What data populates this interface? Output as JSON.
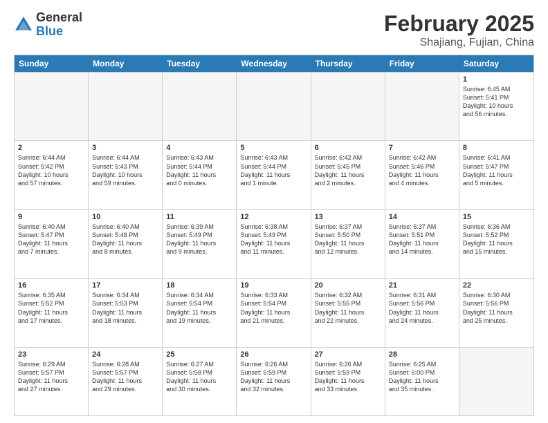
{
  "header": {
    "logo_general": "General",
    "logo_blue": "Blue",
    "month_year": "February 2025",
    "location": "Shajiang, Fujian, China"
  },
  "day_headers": [
    "Sunday",
    "Monday",
    "Tuesday",
    "Wednesday",
    "Thursday",
    "Friday",
    "Saturday"
  ],
  "weeks": [
    [
      {
        "num": "",
        "info": ""
      },
      {
        "num": "",
        "info": ""
      },
      {
        "num": "",
        "info": ""
      },
      {
        "num": "",
        "info": ""
      },
      {
        "num": "",
        "info": ""
      },
      {
        "num": "",
        "info": ""
      },
      {
        "num": "1",
        "info": "Sunrise: 6:45 AM\nSunset: 5:41 PM\nDaylight: 10 hours\nand 56 minutes."
      }
    ],
    [
      {
        "num": "2",
        "info": "Sunrise: 6:44 AM\nSunset: 5:42 PM\nDaylight: 10 hours\nand 57 minutes."
      },
      {
        "num": "3",
        "info": "Sunrise: 6:44 AM\nSunset: 5:43 PM\nDaylight: 10 hours\nand 59 minutes."
      },
      {
        "num": "4",
        "info": "Sunrise: 6:43 AM\nSunset: 5:44 PM\nDaylight: 11 hours\nand 0 minutes."
      },
      {
        "num": "5",
        "info": "Sunrise: 6:43 AM\nSunset: 5:44 PM\nDaylight: 11 hours\nand 1 minute."
      },
      {
        "num": "6",
        "info": "Sunrise: 6:42 AM\nSunset: 5:45 PM\nDaylight: 11 hours\nand 2 minutes."
      },
      {
        "num": "7",
        "info": "Sunrise: 6:42 AM\nSunset: 5:46 PM\nDaylight: 11 hours\nand 4 minutes."
      },
      {
        "num": "8",
        "info": "Sunrise: 6:41 AM\nSunset: 5:47 PM\nDaylight: 11 hours\nand 5 minutes."
      }
    ],
    [
      {
        "num": "9",
        "info": "Sunrise: 6:40 AM\nSunset: 5:47 PM\nDaylight: 11 hours\nand 7 minutes."
      },
      {
        "num": "10",
        "info": "Sunrise: 6:40 AM\nSunset: 5:48 PM\nDaylight: 11 hours\nand 8 minutes."
      },
      {
        "num": "11",
        "info": "Sunrise: 6:39 AM\nSunset: 5:49 PM\nDaylight: 11 hours\nand 9 minutes."
      },
      {
        "num": "12",
        "info": "Sunrise: 6:38 AM\nSunset: 5:49 PM\nDaylight: 11 hours\nand 11 minutes."
      },
      {
        "num": "13",
        "info": "Sunrise: 6:37 AM\nSunset: 5:50 PM\nDaylight: 11 hours\nand 12 minutes."
      },
      {
        "num": "14",
        "info": "Sunrise: 6:37 AM\nSunset: 5:51 PM\nDaylight: 11 hours\nand 14 minutes."
      },
      {
        "num": "15",
        "info": "Sunrise: 6:36 AM\nSunset: 5:52 PM\nDaylight: 11 hours\nand 15 minutes."
      }
    ],
    [
      {
        "num": "16",
        "info": "Sunrise: 6:35 AM\nSunset: 5:52 PM\nDaylight: 11 hours\nand 17 minutes."
      },
      {
        "num": "17",
        "info": "Sunrise: 6:34 AM\nSunset: 5:53 PM\nDaylight: 11 hours\nand 18 minutes."
      },
      {
        "num": "18",
        "info": "Sunrise: 6:34 AM\nSunset: 5:54 PM\nDaylight: 11 hours\nand 19 minutes."
      },
      {
        "num": "19",
        "info": "Sunrise: 6:33 AM\nSunset: 5:54 PM\nDaylight: 11 hours\nand 21 minutes."
      },
      {
        "num": "20",
        "info": "Sunrise: 6:32 AM\nSunset: 5:55 PM\nDaylight: 11 hours\nand 22 minutes."
      },
      {
        "num": "21",
        "info": "Sunrise: 6:31 AM\nSunset: 5:56 PM\nDaylight: 11 hours\nand 24 minutes."
      },
      {
        "num": "22",
        "info": "Sunrise: 6:30 AM\nSunset: 5:56 PM\nDaylight: 11 hours\nand 25 minutes."
      }
    ],
    [
      {
        "num": "23",
        "info": "Sunrise: 6:29 AM\nSunset: 5:57 PM\nDaylight: 11 hours\nand 27 minutes."
      },
      {
        "num": "24",
        "info": "Sunrise: 6:28 AM\nSunset: 5:57 PM\nDaylight: 11 hours\nand 29 minutes."
      },
      {
        "num": "25",
        "info": "Sunrise: 6:27 AM\nSunset: 5:58 PM\nDaylight: 11 hours\nand 30 minutes."
      },
      {
        "num": "26",
        "info": "Sunrise: 6:26 AM\nSunset: 5:59 PM\nDaylight: 11 hours\nand 32 minutes."
      },
      {
        "num": "27",
        "info": "Sunrise: 6:26 AM\nSunset: 5:59 PM\nDaylight: 11 hours\nand 33 minutes."
      },
      {
        "num": "28",
        "info": "Sunrise: 6:25 AM\nSunset: 6:00 PM\nDaylight: 11 hours\nand 35 minutes."
      },
      {
        "num": "",
        "info": ""
      }
    ]
  ]
}
